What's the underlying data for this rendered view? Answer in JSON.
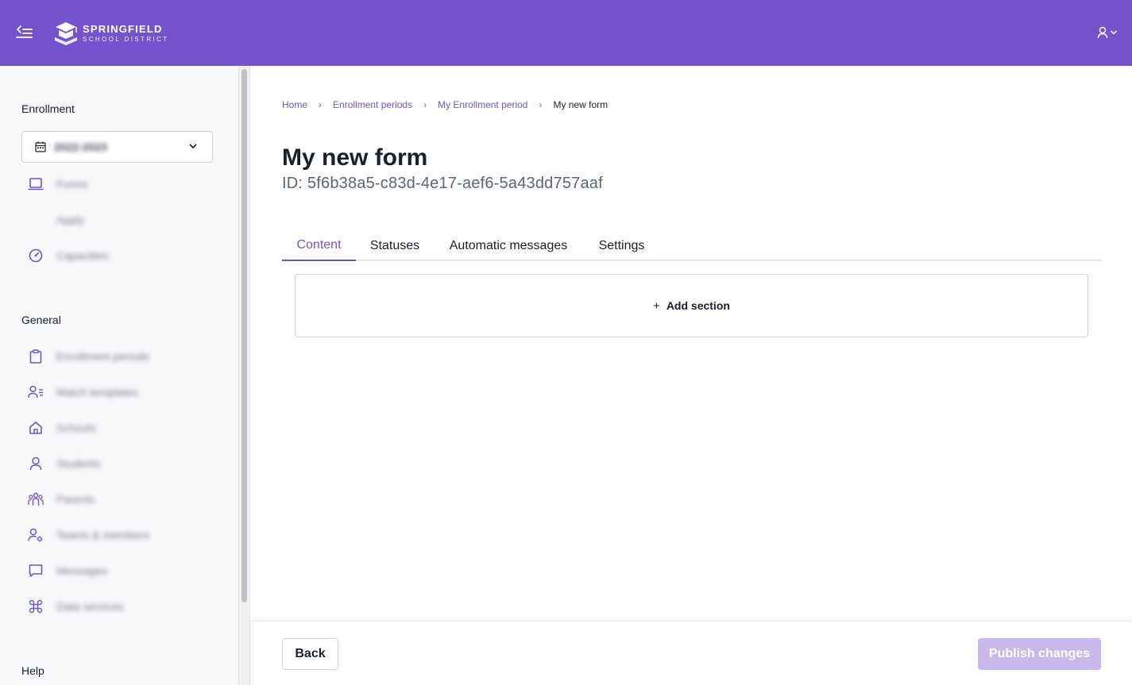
{
  "header": {
    "logo_title": "SPRINGFIELD",
    "logo_subtitle": "SCHOOL DISTRICT",
    "brand_color": "#7553cc"
  },
  "sidebar": {
    "enrollment_label": "Enrollment",
    "year_select_value": "2022-2023",
    "enrollment_items": [
      {
        "label": "Forms",
        "icon": "laptop-icon"
      },
      {
        "label": "Apply",
        "icon": ""
      },
      {
        "label": "Capacities",
        "icon": "gauge-icon"
      }
    ],
    "general_label": "General",
    "general_items": [
      {
        "label": "Enrollment periods",
        "icon": "clipboard-icon"
      },
      {
        "label": "Match templates",
        "icon": "user-list-icon"
      },
      {
        "label": "Schools",
        "icon": "home-icon"
      },
      {
        "label": "Students",
        "icon": "user-icon"
      },
      {
        "label": "Parents",
        "icon": "group-icon"
      },
      {
        "label": "Teams & members",
        "icon": "user-gear-icon"
      },
      {
        "label": "Messages",
        "icon": "message-icon"
      },
      {
        "label": "Data services",
        "icon": "command-icon"
      }
    ],
    "help_label": "Help"
  },
  "breadcrumb": {
    "items": [
      "Home",
      "Enrollment periods",
      "My Enrollment period"
    ],
    "current": "My new form",
    "separator": "›"
  },
  "page": {
    "title": "My new form",
    "id_text": "ID: 5f6b38a5-c83d-4e17-aef6-5a43dd757aaf"
  },
  "tabs": [
    {
      "label": "Content",
      "active": true
    },
    {
      "label": "Statuses",
      "active": false
    },
    {
      "label": "Automatic messages",
      "active": false
    },
    {
      "label": "Settings",
      "active": false
    }
  ],
  "content": {
    "add_section_label": "Add section",
    "add_section_icon": "+"
  },
  "footer": {
    "back_label": "Back",
    "publish_label": "Publish changes"
  }
}
